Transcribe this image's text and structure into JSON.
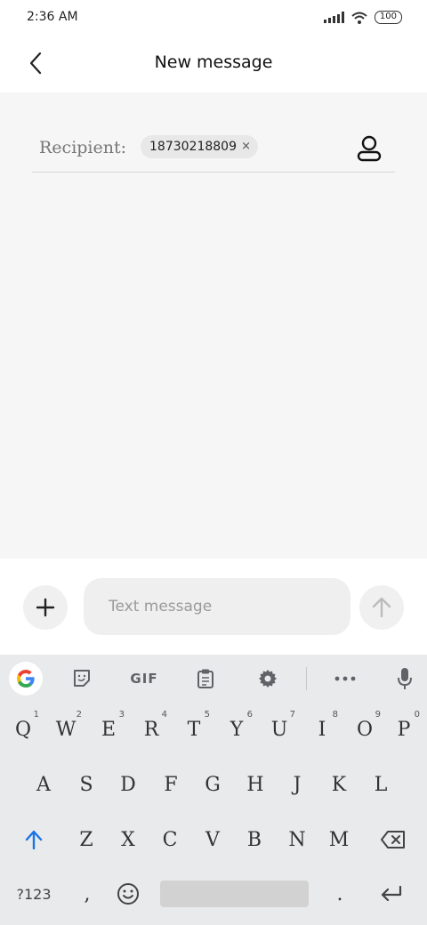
{
  "status_bar": {
    "time": "2:36 AM",
    "battery": "100"
  },
  "header": {
    "title": "New message"
  },
  "recipient": {
    "label": "Recipient:",
    "chip_value": "18730218809",
    "chip_remove": "×"
  },
  "composer": {
    "placeholder": "Text message"
  },
  "keyboard": {
    "toolbar": {
      "gif_label": "GIF"
    },
    "row1": [
      {
        "label": "Q",
        "hint": "1"
      },
      {
        "label": "W",
        "hint": "2"
      },
      {
        "label": "E",
        "hint": "3"
      },
      {
        "label": "R",
        "hint": "4"
      },
      {
        "label": "T",
        "hint": "5"
      },
      {
        "label": "Y",
        "hint": "6"
      },
      {
        "label": "U",
        "hint": "7"
      },
      {
        "label": "I",
        "hint": "8"
      },
      {
        "label": "O",
        "hint": "9"
      },
      {
        "label": "P",
        "hint": "0"
      }
    ],
    "row2": [
      "A",
      "S",
      "D",
      "F",
      "G",
      "H",
      "J",
      "K",
      "L"
    ],
    "row3": [
      "Z",
      "X",
      "C",
      "V",
      "B",
      "N",
      "M"
    ],
    "symbols_label": "?123",
    "comma_label": ",",
    "period_label": "."
  },
  "colors": {
    "accent_blue": "#1a73e8",
    "compose_bg": "#f6f6f6",
    "keyboard_bg": "#e9eaeb"
  },
  "icons": [
    "back-icon",
    "contact-icon",
    "plus-icon",
    "send-arrow-icon",
    "google-icon",
    "sticker-icon",
    "clipboard-icon",
    "settings-icon",
    "more-icon",
    "mic-icon",
    "shift-icon",
    "backspace-icon",
    "emoji-icon",
    "enter-icon",
    "wifi-icon",
    "signal-icon"
  ]
}
